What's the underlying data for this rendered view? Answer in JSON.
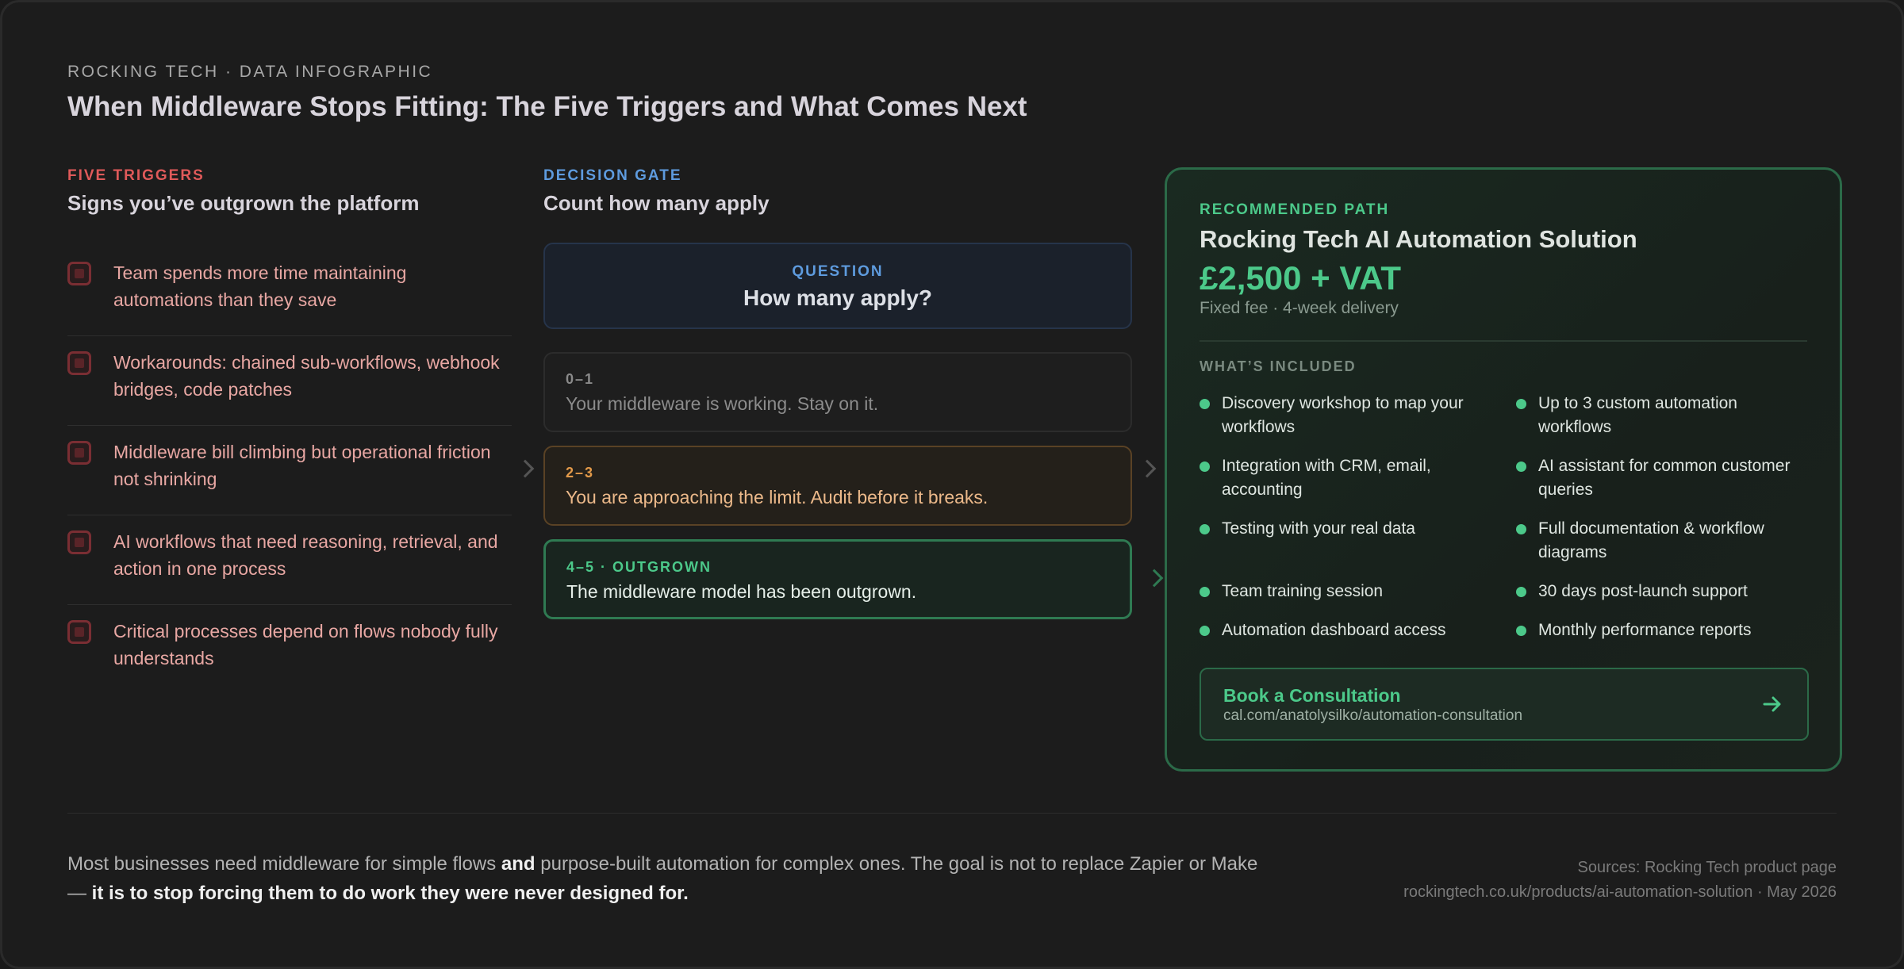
{
  "header": {
    "eyebrow": "ROCKING TECH · DATA INFOGRAPHIC",
    "title": "When Middleware Stops Fitting: The Five Triggers and What Comes Next"
  },
  "triggers": {
    "label": "FIVE TRIGGERS",
    "subtitle": "Signs you’ve outgrown the platform",
    "items": [
      "Team spends more time maintaining automations than they save",
      "Workarounds: chained sub-workflows, webhook bridges, code patches",
      "Middleware bill climbing but operational friction not shrinking",
      "AI workflows that need reasoning, retrieval, and action in one process",
      "Critical processes depend on flows nobody fully understands"
    ]
  },
  "gate": {
    "label": "DECISION GATE",
    "subtitle": "Count how many apply",
    "question_label": "QUESTION",
    "question": "How many apply?",
    "outcomes": [
      {
        "range": "0–1",
        "text": "Your middleware is working. Stay on it."
      },
      {
        "range": "2–3",
        "text": "You are approaching the limit. Audit before it breaks."
      },
      {
        "range": "4–5 · OUTGROWN",
        "text": "The middleware model has been outgrown."
      }
    ]
  },
  "recommended": {
    "label": "RECOMMENDED PATH",
    "title": "Rocking Tech AI Automation Solution",
    "price": "£2,500 + VAT",
    "terms": "Fixed fee · 4-week delivery",
    "included_label": "WHAT’S INCLUDED",
    "included": [
      "Discovery workshop to map your workflows",
      "Up to 3 custom automation workflows",
      "Integration with CRM, email, accounting",
      "AI assistant for common customer queries",
      "Testing with your real data",
      "Full documentation & workflow diagrams",
      "Team training session",
      "30 days post-launch support",
      "Automation dashboard access",
      "Monthly performance reports"
    ],
    "cta_title": "Book a Consultation",
    "cta_url": "cal.com/anatolysilko/automation-consultation"
  },
  "footer": {
    "text_1": "Most businesses need middleware for simple flows ",
    "text_2": "and",
    "text_3": " purpose-built automation for complex ones. The goal is not to replace Zapier or Make — ",
    "text_4": "it is to stop forcing them to do work they were never designed for.",
    "sources_1": "Sources: Rocking Tech product page",
    "sources_2": "rockingtech.co.uk/products/ai-automation-solution · May 2026"
  },
  "colors": {
    "trigger_accent": "#e05a5a",
    "gate_accent": "#5e9bde",
    "mid_accent": "#e39a4a",
    "path_accent": "#4cc98a"
  }
}
